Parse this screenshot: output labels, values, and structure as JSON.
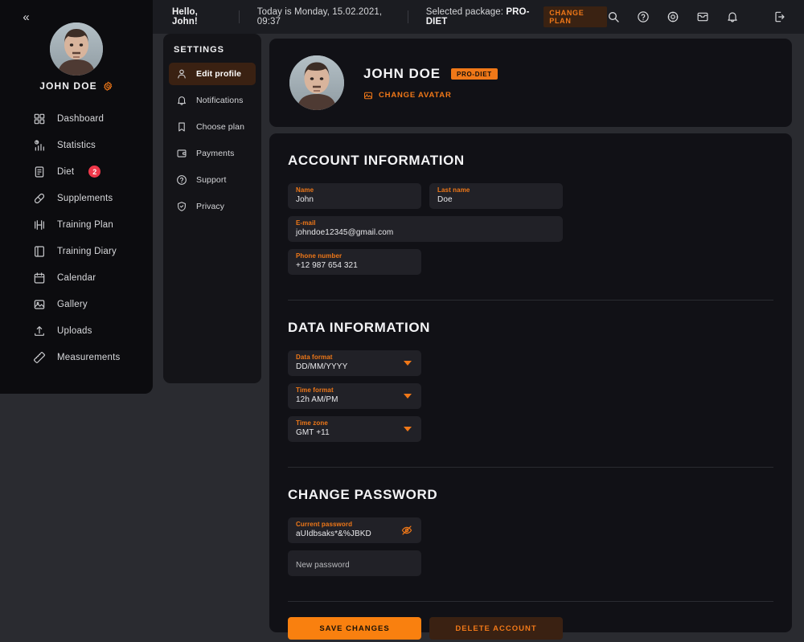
{
  "sidebar": {
    "collapse_icon": "chevron-double-left-icon",
    "user_name": "JOHN DOE",
    "user_gear_icon": "gear-icon",
    "items": [
      {
        "label": "Dashboard",
        "icon": "grid-icon",
        "badge": null
      },
      {
        "label": "Statistics",
        "icon": "chart-bars-icon",
        "badge": null
      },
      {
        "label": "Diet",
        "icon": "clipboard-icon",
        "badge": "2"
      },
      {
        "label": "Supplements",
        "icon": "pill-icon",
        "badge": null
      },
      {
        "label": "Training Plan",
        "icon": "dumbbell-icon",
        "badge": null
      },
      {
        "label": "Training Diary",
        "icon": "book-icon",
        "badge": null
      },
      {
        "label": "Calendar",
        "icon": "calendar-icon",
        "badge": null
      },
      {
        "label": "Gallery",
        "icon": "image-icon",
        "badge": null
      },
      {
        "label": "Uploads",
        "icon": "upload-icon",
        "badge": null
      },
      {
        "label": "Measurements",
        "icon": "ruler-icon",
        "badge": null
      }
    ]
  },
  "topbar": {
    "greeting": "Hello, John!",
    "date_text": "Today is Monday, 15.02.2021, 09:37",
    "package_label": "Selected package:",
    "package_value": "PRO-DIET",
    "change_plan_label": "CHANGE PLAN",
    "icons": [
      "search-icon",
      "help-circle-icon",
      "gear-icon",
      "inbox-icon",
      "bell-icon",
      "logout-icon"
    ]
  },
  "settings": {
    "title": "SETTINGS",
    "items": [
      {
        "label": "Edit profile",
        "icon": "user-icon",
        "active": true
      },
      {
        "label": "Notifications",
        "icon": "bell-icon",
        "active": false
      },
      {
        "label": "Choose plan",
        "icon": "bookmark-icon",
        "active": false
      },
      {
        "label": "Payments",
        "icon": "wallet-icon",
        "active": false
      },
      {
        "label": "Support",
        "icon": "help-circle-icon",
        "active": false
      },
      {
        "label": "Privacy",
        "icon": "shield-check-icon",
        "active": false
      }
    ]
  },
  "profile": {
    "name": "JOHN DOE",
    "badge": "PRO-DIET",
    "change_avatar_label": "CHANGE AVATAR",
    "change_avatar_icon": "image-icon",
    "avatar_icon": "user-avatar"
  },
  "account": {
    "title": "ACCOUNT INFORMATION",
    "fields": [
      {
        "label": "Name",
        "value": "John"
      },
      {
        "label": "Last name",
        "value": "Doe"
      },
      {
        "label": "E-mail",
        "value": "johndoe12345@gmail.com"
      },
      {
        "label": "Phone number",
        "value": "+12 987 654 321"
      }
    ]
  },
  "data_information": {
    "title": "DATA INFORMATION",
    "fields": [
      {
        "label": "Data format",
        "value": "DD/MM/YYYY",
        "icon": "chevron-down-icon"
      },
      {
        "label": "Time format",
        "value": "12h AM/PM",
        "icon": "chevron-down-icon"
      },
      {
        "label": "Time zone",
        "value": "GMT +11",
        "icon": "chevron-down-icon"
      }
    ]
  },
  "change_password": {
    "title": "CHANGE PASSWORD",
    "current": {
      "label": "Current password",
      "value": "aUIdbsaks*&%JBKD",
      "toggle_icon": "eye-off-icon"
    },
    "new": {
      "placeholder": "New password"
    }
  },
  "actions": {
    "save_label": "SAVE CHANGES",
    "delete_label": "DELETE ACCOUNT"
  },
  "colors": {
    "accent": "#f07818",
    "accent_button": "#f9800f",
    "accent_muted_bg": "#3a2112",
    "badge_red": "#f0384a",
    "panel": "#111116",
    "sidebar": "#0c0c0f",
    "field": "#212127",
    "page_bg": "#2a2b30",
    "topbar": "#1b1c21"
  }
}
